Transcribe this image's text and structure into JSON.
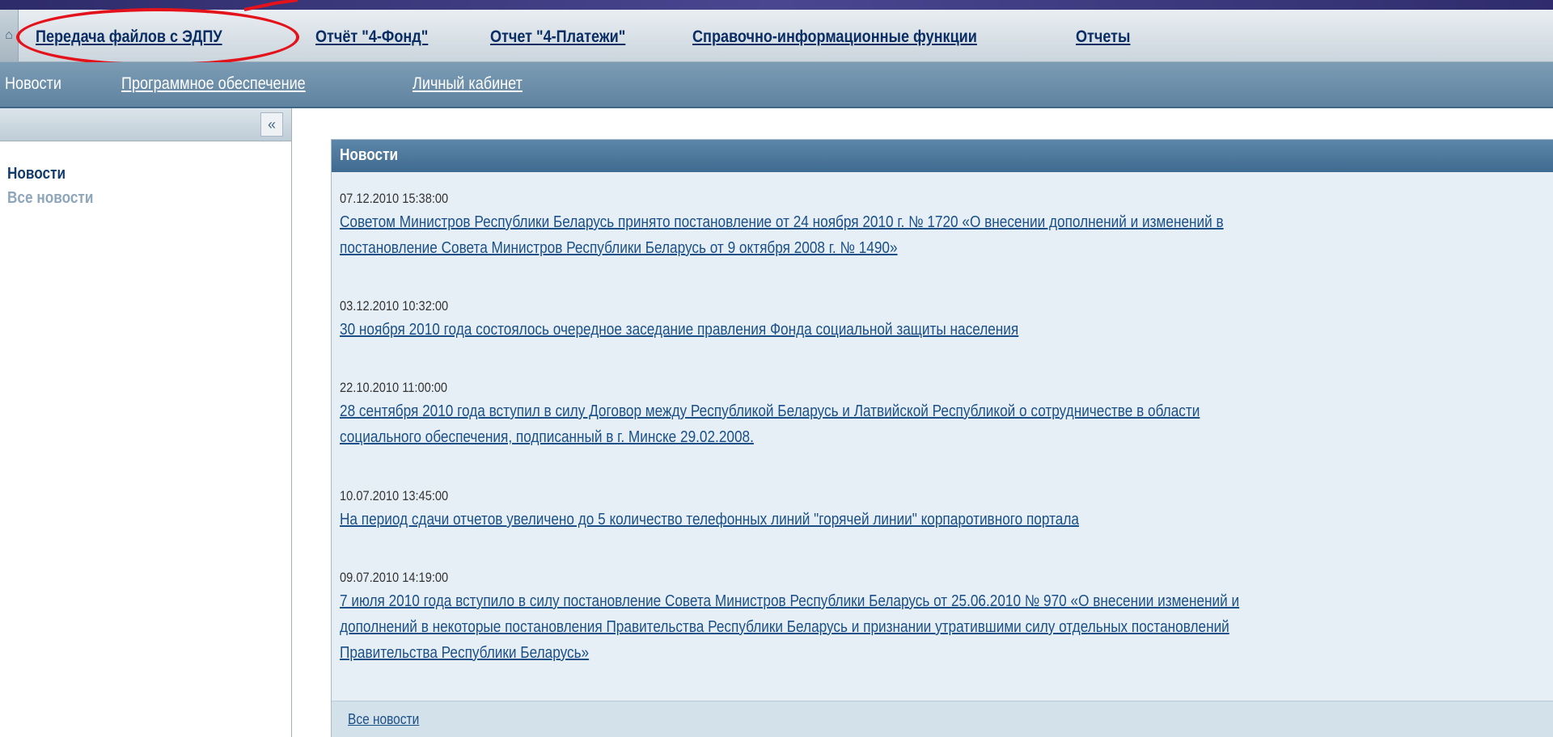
{
  "main_nav": {
    "items": [
      {
        "label": "Передача файлов с ЭДПУ"
      },
      {
        "label": "Отчёт \"4-Фонд\""
      },
      {
        "label": "Отчет \"4-Платежи\""
      },
      {
        "label": "Справочно-информационные функции"
      },
      {
        "label": "Отчеты"
      }
    ],
    "home_icon": "home-icon"
  },
  "sub_nav": {
    "items": [
      {
        "label": "Новости"
      },
      {
        "label": "Программное обеспечение"
      },
      {
        "label": "Личный кабинет"
      }
    ]
  },
  "sidebar": {
    "collapse_symbol": "«",
    "heading": "Новости",
    "link": "Все новости"
  },
  "panel": {
    "title": "Новости",
    "news": [
      {
        "date": "07.12.2010 15:38:00",
        "lines": [
          "Советом Министров Республики Беларусь принято постановление от 24 ноября 2010 г. № 1720 «О внесении дополнений и изменений в",
          "постановление Совета Министров Республики Беларусь от 9 октября 2008 г. № 1490»"
        ]
      },
      {
        "date": "03.12.2010 10:32:00",
        "lines": [
          "30 ноября 2010 года состоялось очередное заседание правления Фонда социальной защиты населения"
        ]
      },
      {
        "date": "22.10.2010 11:00:00",
        "lines": [
          "28 сентября 2010 года вступил в силу Договор между Республикой Беларусь и Латвийской Республикой о сотрудничестве в области",
          "социального обеспечения, подписанный в г. Минске 29.02.2008."
        ]
      },
      {
        "date": "10.07.2010 13:45:00",
        "lines": [
          "На период сдачи отчетов увеличено до 5 количество телефонных линий \"горячей линии\" корпаротивного портала"
        ]
      },
      {
        "date": "09.07.2010 14:19:00",
        "lines": [
          "7 июля 2010 года вступило в силу постановление Совета Министров Республики Беларусь от 25.06.2010 № 970 «О внесении изменений и",
          "дополнений в некоторые постановления Правительства Республики Беларусь и признании утратившими силу отдельных постановлений",
          "Правительства Республики Беларусь»"
        ]
      }
    ],
    "footer_link": "Все новости"
  },
  "colors": {
    "highlight": "#e3121b",
    "link": "#1b4f87",
    "panel_header": "#3f6b90"
  }
}
